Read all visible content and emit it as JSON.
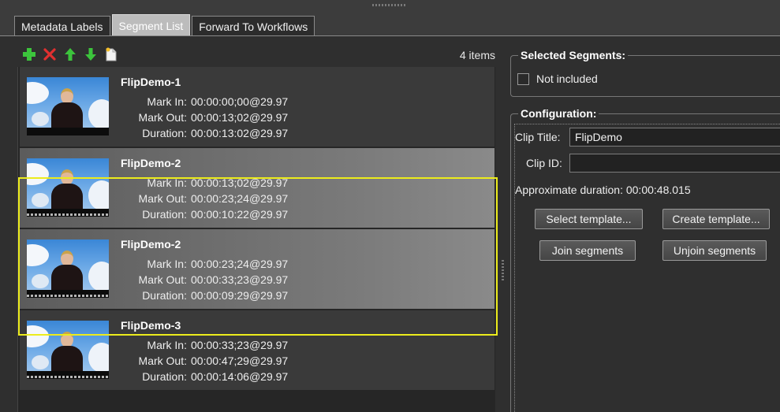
{
  "tabs": [
    {
      "label": "Metadata Labels"
    },
    {
      "label": "Segment List"
    },
    {
      "label": "Forward To Workflows"
    }
  ],
  "segment_list": {
    "item_count": "4 items",
    "field_labels": {
      "mark_in": "Mark In:",
      "mark_out": "Mark Out:",
      "duration": "Duration:"
    },
    "items": [
      {
        "title": "FlipDemo-1",
        "mark_in": "00:00:00;00@29.97",
        "mark_out": "00:00:13;02@29.97",
        "duration": "00:00:13:02@29.97",
        "selected": false
      },
      {
        "title": "FlipDemo-2",
        "mark_in": "00:00:13;02@29.97",
        "mark_out": "00:00:23;24@29.97",
        "duration": "00:00:10:22@29.97",
        "selected": true
      },
      {
        "title": "FlipDemo-2",
        "mark_in": "00:00:23;24@29.97",
        "mark_out": "00:00:33;23@29.97",
        "duration": "00:00:09:29@29.97",
        "selected": true
      },
      {
        "title": "FlipDemo-3",
        "mark_in": "00:00:33;23@29.97",
        "mark_out": "00:00:47;29@29.97",
        "duration": "00:00:14:06@29.97",
        "selected": false
      }
    ]
  },
  "toolbar_icons": [
    "add-icon",
    "delete-icon",
    "move-up-icon",
    "move-down-icon",
    "new-document-icon"
  ],
  "selected_segments": {
    "title": "Selected Segments:",
    "not_included_label": "Not included",
    "not_included_checked": false
  },
  "configuration": {
    "title": "Configuration:",
    "clip_title_label": "Clip Title:",
    "clip_title_value": "FlipDemo",
    "clip_id_label": "Clip ID:",
    "clip_id_value": "",
    "approx_duration": "Approximate duration: 00:00:48.015",
    "buttons": {
      "select_template": "Select template...",
      "create_template": "Create template...",
      "join_segments": "Join segments",
      "unjoin_segments": "Unjoin segments"
    }
  },
  "colors": {
    "selection_border": "#ecec1c",
    "add_icon": "#3cc43c",
    "delete_icon": "#e03030",
    "arrow_icons": "#3cc43c",
    "background": "#2f2f2f"
  }
}
